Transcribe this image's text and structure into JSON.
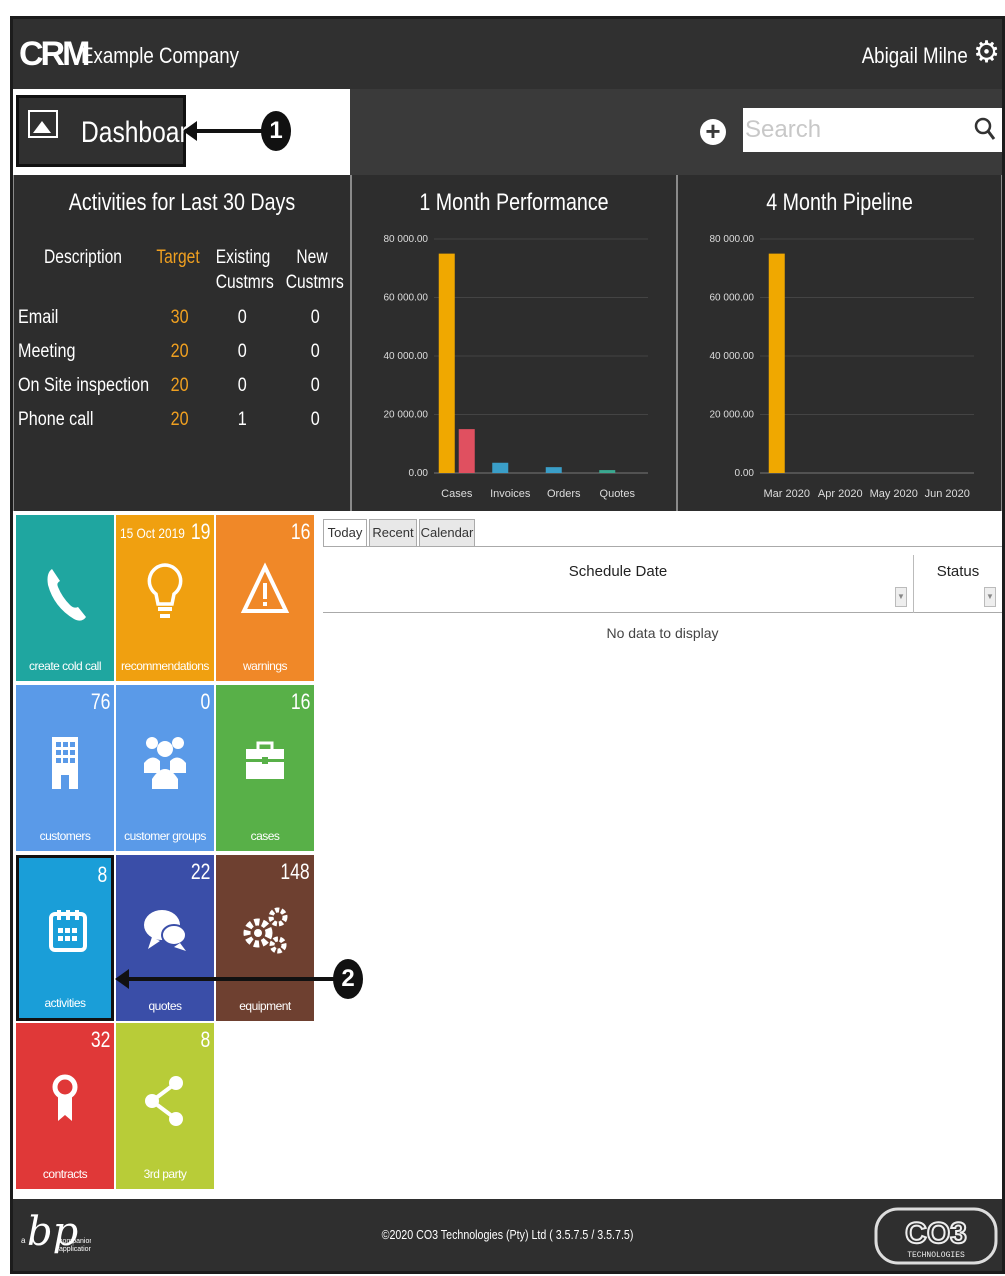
{
  "header": {
    "logo": "CRM",
    "company": "Example Company",
    "user": "Abigail Milne",
    "settings_icon": "gear-icon"
  },
  "titlebar": {
    "page_title": "Dashboard",
    "page_icon": "image-icon",
    "search_placeholder": "Search",
    "callout_1": "1"
  },
  "activities": {
    "title": "Activities for Last 30 Days",
    "headers": {
      "description": "Description",
      "target": "Target",
      "existing_1": "Existing",
      "existing_2": "Custmrs",
      "new_1": "New",
      "new_2": "Custmrs"
    },
    "rows": [
      {
        "description": "Email",
        "target": "30",
        "existing": "0",
        "new": "0"
      },
      {
        "description": "Meeting",
        "target": "20",
        "existing": "0",
        "new": "0"
      },
      {
        "description": "On Site inspection",
        "target": "20",
        "existing": "0",
        "new": "0"
      },
      {
        "description": "Phone call",
        "target": "20",
        "existing": "1",
        "new": "0"
      }
    ],
    "colors": {
      "target": "#f0a020"
    }
  },
  "chart_data": [
    {
      "type": "bar",
      "title": "1 Month Performance",
      "categories": [
        "Cases",
        "Invoices",
        "Orders",
        "Quotes"
      ],
      "series": [
        {
          "values": [
            75000,
            3500,
            2000,
            1000
          ],
          "color": "#f0a800"
        },
        {
          "values": [
            15000,
            0,
            0,
            0
          ],
          "color": "#e05060"
        }
      ],
      "secondary_colors": [
        "#e05060",
        "#3a9ec8",
        "#3a9ec8",
        "#3aa890"
      ],
      "yticks": [
        "0.00",
        "20 000.00",
        "40 000.00",
        "60 000.00",
        "80 000.00"
      ],
      "ylim": [
        0,
        80000
      ],
      "grid": true
    },
    {
      "type": "bar",
      "title": "4 Month Pipeline",
      "categories": [
        "Mar 2020",
        "Apr 2020",
        "May 2020",
        "Jun 2020"
      ],
      "series": [
        {
          "values": [
            75000,
            0,
            0,
            0
          ],
          "color": "#f0a800"
        }
      ],
      "yticks": [
        "0.00",
        "20 000.00",
        "40 000.00",
        "60 000.00",
        "80 000.00"
      ],
      "ylim": [
        0,
        80000
      ],
      "grid": true
    }
  ],
  "tiles": [
    {
      "label": "create cold call",
      "count": "",
      "date": "",
      "color": "#1fa6a0",
      "icon": "phone-icon"
    },
    {
      "label": "recommendations",
      "count": "19",
      "date": "15 Oct 2019",
      "color": "#f0a010",
      "icon": "lightbulb-icon"
    },
    {
      "label": "warnings",
      "count": "16",
      "date": "",
      "color": "#f08828",
      "icon": "warning-icon"
    },
    {
      "label": "customers",
      "count": "76",
      "date": "",
      "color": "#5a9ae8",
      "icon": "building-icon"
    },
    {
      "label": "customer groups",
      "count": "0",
      "date": "",
      "color": "#5a9ae8",
      "icon": "group-icon"
    },
    {
      "label": "cases",
      "count": "16",
      "date": "",
      "color": "#58b048",
      "icon": "briefcase-icon"
    },
    {
      "label": "activities",
      "count": "8",
      "date": "",
      "color": "#1a9ed8",
      "icon": "calendar-icon"
    },
    {
      "label": "quotes",
      "count": "22",
      "date": "",
      "color": "#3a4ea8",
      "icon": "chat-icon"
    },
    {
      "label": "equipment",
      "count": "148",
      "date": "",
      "color": "#6e4030",
      "icon": "gears-icon"
    },
    {
      "label": "contracts",
      "count": "32",
      "date": "",
      "color": "#e03838",
      "icon": "ribbon-icon"
    },
    {
      "label": "3rd party",
      "count": "8",
      "date": "",
      "color": "#b8cc38",
      "icon": "share-icon"
    }
  ],
  "callout_2": "2",
  "grid": {
    "tabs": [
      "Today",
      "Recent",
      "Calendar"
    ],
    "active_tab": "Today",
    "columns": [
      "Schedule Date",
      "Status"
    ],
    "empty_text": "No data to display"
  },
  "footer": {
    "bp_logo": "bp",
    "bp_sub_1": "companion",
    "bp_sub_2": "application",
    "bp_prefix": "a",
    "copyright": "©2020 CO3 Technologies (Pty) Ltd ( 3.5.7.5 / 3.5.7.5)",
    "co3_logo": "CO3",
    "co3_sub": "TECHNOLOGIES"
  }
}
